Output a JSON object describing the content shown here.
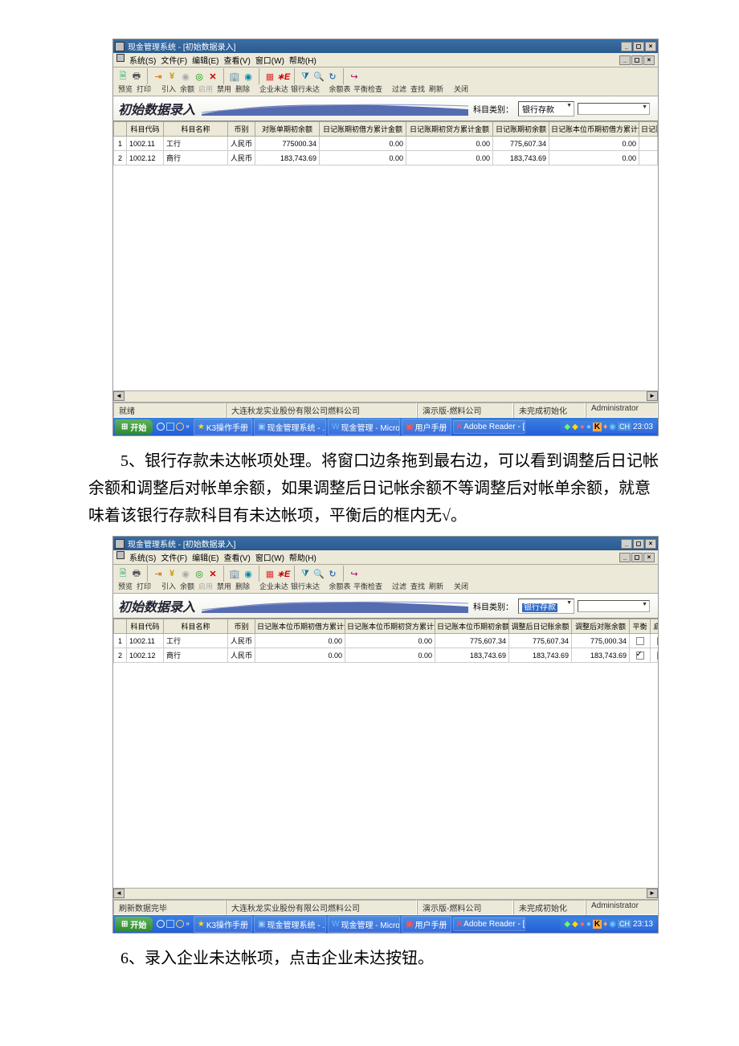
{
  "paragraphs": {
    "p5a": "5、银行存款未达帐项处理。将窗口边条拖到最右边，可以看到调整后日记帐余额和调整后对帐单余额，如果调整后日记帐余额不等调整后对帐单余额，就意味着该银行存款科目有未达帐项，平衡后的框内无√。",
    "p6a": "6、录入企业未达帐项，点击企业未达按钮。"
  },
  "app": {
    "title": "现金管理系统 - [初始数据录入]",
    "menus": [
      "系统(S)",
      "文件(F)",
      "编辑(E)",
      "查看(V)",
      "窗口(W)",
      "帮助(H)"
    ]
  },
  "toolbar": {
    "labels": [
      "预览",
      "打印",
      "引入",
      "余额",
      "启用",
      "禁用",
      "删除",
      "企业未达",
      "银行未达",
      "余额表",
      "平衡检查",
      "过滤",
      "查找",
      "刷新",
      "关闭"
    ]
  },
  "subtitle": "初始数据录入",
  "classLabel": "科目类别：",
  "classValue": "银行存款",
  "grid1": {
    "cols": [
      "",
      "科目代码",
      "科目名称",
      "币别",
      "对账单期初余额",
      "日记账期初借方累计金额",
      "日记账期初贷方累计金额",
      "日记账期初余额",
      "日记账本位币期初借方累计金额",
      "日记账本位币期"
    ],
    "rows": [
      {
        "n": "1",
        "code": "1002.11",
        "name": "工行",
        "cur": "人民币",
        "c1": "775000.34",
        "c2": "0.00",
        "c3": "0.00",
        "c4": "775,607.34",
        "c5": "0.00"
      },
      {
        "n": "2",
        "code": "1002.12",
        "name": "商行",
        "cur": "人民币",
        "c1": "183,743.69",
        "c2": "0.00",
        "c3": "0.00",
        "c4": "183,743.69",
        "c5": "0.00"
      }
    ]
  },
  "grid2": {
    "cols": [
      "",
      "科目代码",
      "科目名称",
      "币别",
      "日记账本位币期初借方累计金额",
      "日记账本位币期初贷方累计金额",
      "日记账本位币期初余额",
      "调整后日记账余额",
      "调整后对账余额",
      "平衡",
      "启用"
    ],
    "rows": [
      {
        "n": "1",
        "code": "1002.11",
        "name": "工行",
        "cur": "人民币",
        "c1": "0.00",
        "c2": "0.00",
        "c3": "775,607.34",
        "c4": "775,607.34",
        "c5": "775,000.34",
        "bal": false,
        "en": false
      },
      {
        "n": "2",
        "code": "1002.12",
        "name": "商行",
        "cur": "人民币",
        "c1": "0.00",
        "c2": "0.00",
        "c3": "183,743.69",
        "c4": "183,743.69",
        "c5": "183,743.69",
        "bal": true,
        "en": false
      }
    ]
  },
  "status1": {
    "left": "就绪",
    "company": "大连秋龙实业股份有限公司燃料公司",
    "demo": "演示版-燃料公司",
    "init": "未完成初始化",
    "user": "Administrator"
  },
  "status2": {
    "left": "刷新数据完毕",
    "company": "大连秋龙实业股份有限公司燃料公司",
    "demo": "演示版-燃料公司",
    "init": "未完成初始化",
    "user": "Administrator"
  },
  "taskbar": {
    "start": "开始",
    "items": [
      "K3操作手册",
      "现金管理系统 - ...",
      "现金管理 - Micro...",
      "用户手册",
      "Adobe Reader - [..."
    ],
    "time1": "23:03",
    "time2": "23:13"
  },
  "tray": {
    "text": "CH"
  }
}
